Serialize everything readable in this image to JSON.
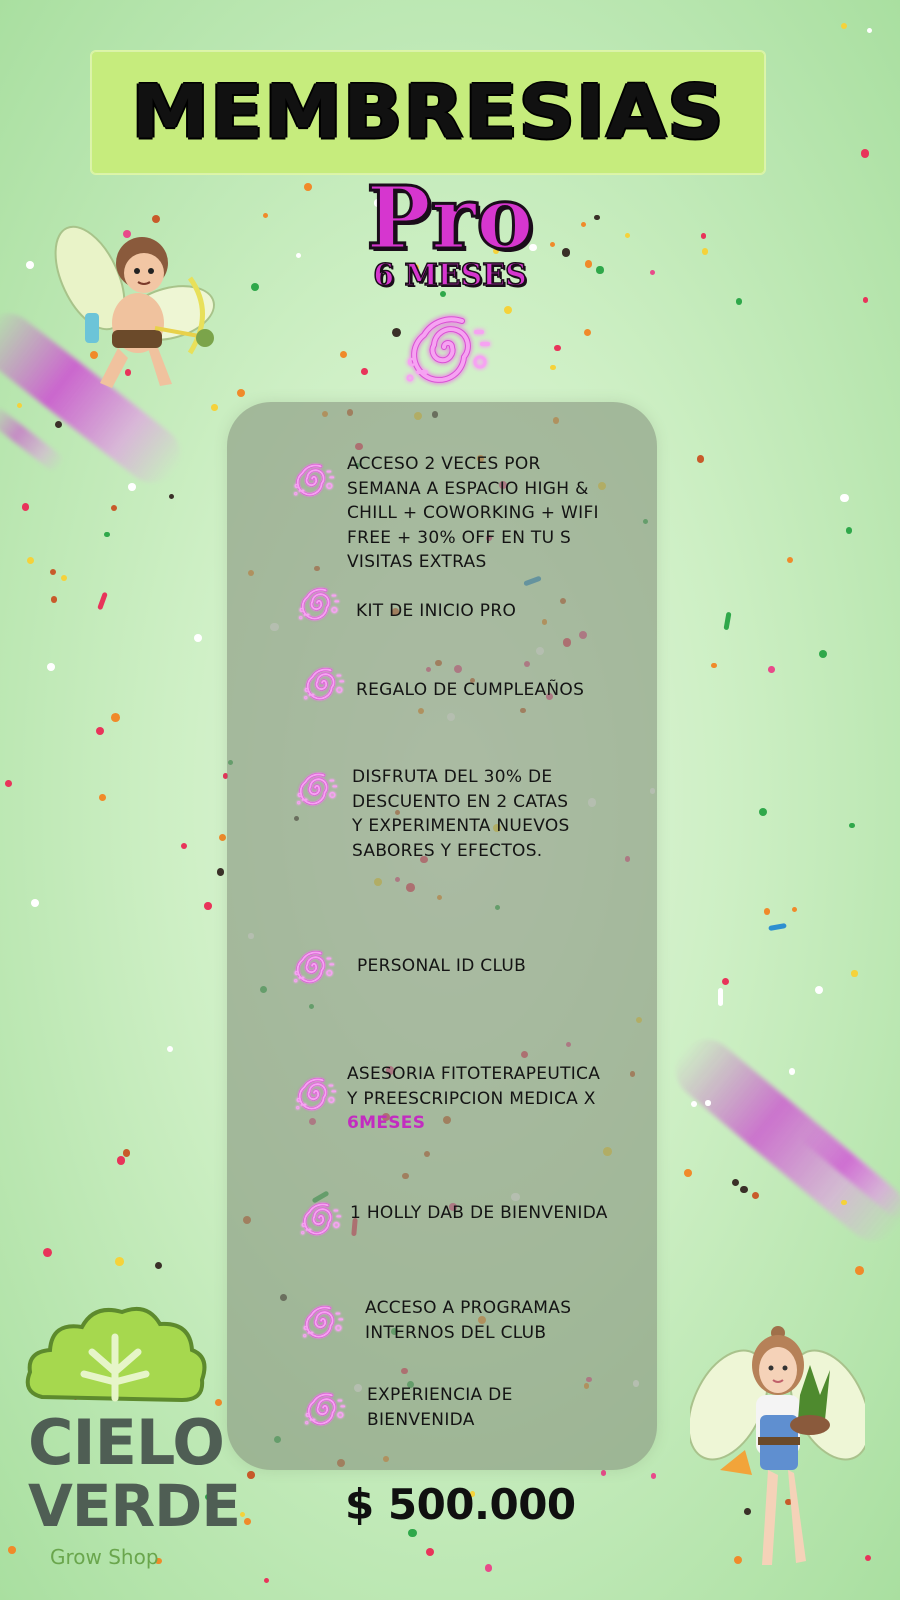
{
  "header": {
    "title": "MEMBRESIAS"
  },
  "tier": {
    "name": "Pro",
    "duration": "6 MESES"
  },
  "benefits": [
    {
      "text": "ACCESO 2 VECES  POR\nSEMANA A ESPACIO HIGH &\nCHILL + COWORKING + WIFI\nFREE  + 30% OFF EN TU S\nVISITAS EXTRAS"
    },
    {
      "text": "KIT DE INICIO PRO"
    },
    {
      "text": "REGALO DE CUMPLEAÑOS"
    },
    {
      "text": "DISFRUTA DEL 30% DE\nDESCUENTO EN 2 CATAS\nY EXPERIMENTA NUEVOS\nSABORES Y EFECTOS."
    },
    {
      "text": "PERSONAL ID CLUB"
    },
    {
      "text": "ASESORIA FITOTERAPEUTICA\nY PREESCRIPCION MEDICA X",
      "highlight": "6MESES"
    },
    {
      "text": "1 HOLLY DAB DE BIENVENIDA"
    },
    {
      "text": "ACCESO A PROGRAMAS\nINTERNOS DEL CLUB"
    },
    {
      "text": "EXPERIENCIA DE\nBIENVENIDA"
    }
  ],
  "price": "$ 500.000",
  "logo": {
    "line1": "CIELO",
    "line2": "VERDE",
    "subtitle": "Grow Shop"
  },
  "icons": {
    "benefit": "neon-spiral-icon",
    "tier": "neon-spiral-icon",
    "logo": "cannabis-leaf-cloud-icon"
  },
  "colors": {
    "accent_magenta": "#d636cf",
    "banner_green": "#c6ec7d",
    "panel_gray_green": "#879680",
    "logo_gray": "#4f5e54",
    "logo_green": "#6aa64d"
  }
}
